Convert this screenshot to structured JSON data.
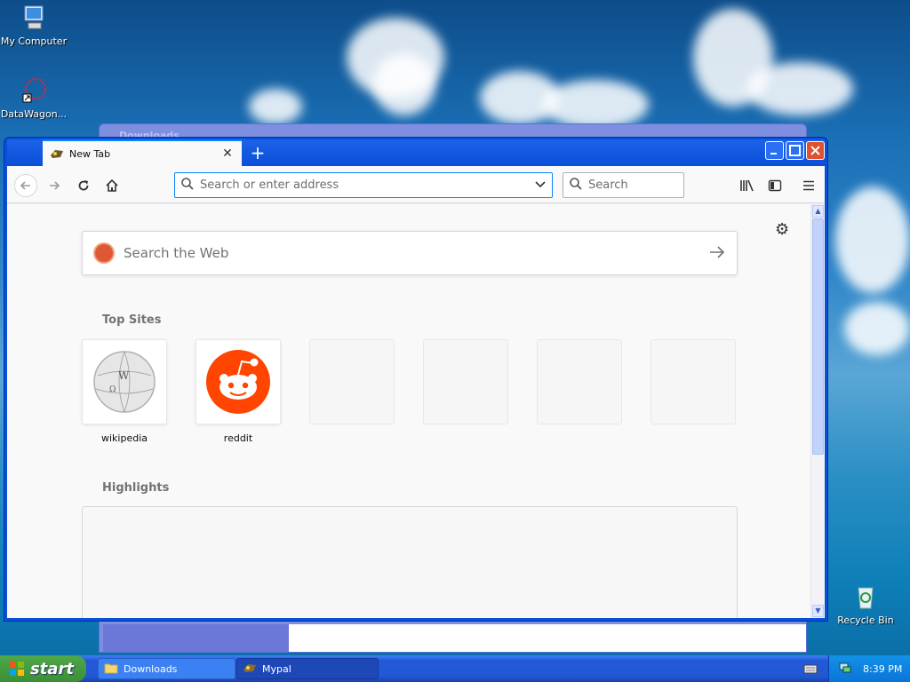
{
  "desktop": {
    "icons": [
      {
        "label": "My Computer"
      },
      {
        "label": "DataWagon..."
      },
      {
        "label": "Recycle Bin"
      }
    ]
  },
  "background_window": {
    "title": "Downloads"
  },
  "browser": {
    "tab": {
      "title": "New Tab"
    },
    "urlbar": {
      "placeholder": "Search or enter address"
    },
    "searchbar": {
      "placeholder": "Search"
    },
    "websearch": {
      "placeholder": "Search the Web"
    },
    "top_sites_heading": "Top Sites",
    "top_sites": [
      {
        "label": "wikipedia"
      },
      {
        "label": "reddit"
      }
    ],
    "highlights_heading": "Highlights"
  },
  "taskbar": {
    "start_label": "start",
    "tasks": [
      {
        "label": "Downloads"
      },
      {
        "label": "Mypal"
      }
    ],
    "clock": "8:39 PM"
  },
  "colors": {
    "accent": "#0a84ff",
    "xp_title_blue": "#0a4fd8",
    "reddit": "#ff4500",
    "duckduckgo": "#de5833"
  }
}
